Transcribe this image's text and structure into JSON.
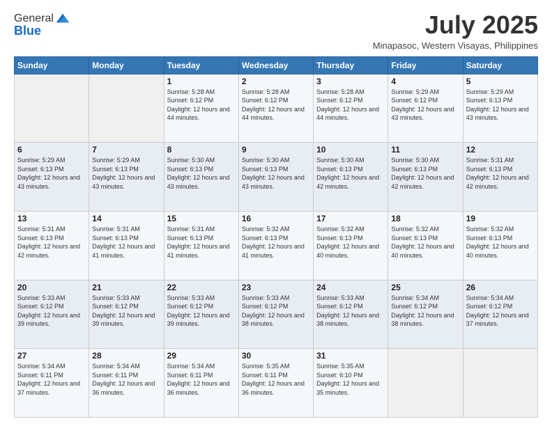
{
  "header": {
    "logo_general": "General",
    "logo_blue": "Blue",
    "month_title": "July 2025",
    "location": "Minapasoc, Western Visayas, Philippines"
  },
  "days_of_week": [
    "Sunday",
    "Monday",
    "Tuesday",
    "Wednesday",
    "Thursday",
    "Friday",
    "Saturday"
  ],
  "weeks": [
    [
      {
        "day": "",
        "info": ""
      },
      {
        "day": "",
        "info": ""
      },
      {
        "day": "1",
        "info": "Sunrise: 5:28 AM\nSunset: 6:12 PM\nDaylight: 12 hours and 44 minutes."
      },
      {
        "day": "2",
        "info": "Sunrise: 5:28 AM\nSunset: 6:12 PM\nDaylight: 12 hours and 44 minutes."
      },
      {
        "day": "3",
        "info": "Sunrise: 5:28 AM\nSunset: 6:12 PM\nDaylight: 12 hours and 44 minutes."
      },
      {
        "day": "4",
        "info": "Sunrise: 5:29 AM\nSunset: 6:12 PM\nDaylight: 12 hours and 43 minutes."
      },
      {
        "day": "5",
        "info": "Sunrise: 5:29 AM\nSunset: 6:13 PM\nDaylight: 12 hours and 43 minutes."
      }
    ],
    [
      {
        "day": "6",
        "info": "Sunrise: 5:29 AM\nSunset: 6:13 PM\nDaylight: 12 hours and 43 minutes."
      },
      {
        "day": "7",
        "info": "Sunrise: 5:29 AM\nSunset: 6:13 PM\nDaylight: 12 hours and 43 minutes."
      },
      {
        "day": "8",
        "info": "Sunrise: 5:30 AM\nSunset: 6:13 PM\nDaylight: 12 hours and 43 minutes."
      },
      {
        "day": "9",
        "info": "Sunrise: 5:30 AM\nSunset: 6:13 PM\nDaylight: 12 hours and 43 minutes."
      },
      {
        "day": "10",
        "info": "Sunrise: 5:30 AM\nSunset: 6:13 PM\nDaylight: 12 hours and 42 minutes."
      },
      {
        "day": "11",
        "info": "Sunrise: 5:30 AM\nSunset: 6:13 PM\nDaylight: 12 hours and 42 minutes."
      },
      {
        "day": "12",
        "info": "Sunrise: 5:31 AM\nSunset: 6:13 PM\nDaylight: 12 hours and 42 minutes."
      }
    ],
    [
      {
        "day": "13",
        "info": "Sunrise: 5:31 AM\nSunset: 6:13 PM\nDaylight: 12 hours and 42 minutes."
      },
      {
        "day": "14",
        "info": "Sunrise: 5:31 AM\nSunset: 6:13 PM\nDaylight: 12 hours and 41 minutes."
      },
      {
        "day": "15",
        "info": "Sunrise: 5:31 AM\nSunset: 6:13 PM\nDaylight: 12 hours and 41 minutes."
      },
      {
        "day": "16",
        "info": "Sunrise: 5:32 AM\nSunset: 6:13 PM\nDaylight: 12 hours and 41 minutes."
      },
      {
        "day": "17",
        "info": "Sunrise: 5:32 AM\nSunset: 6:13 PM\nDaylight: 12 hours and 40 minutes."
      },
      {
        "day": "18",
        "info": "Sunrise: 5:32 AM\nSunset: 6:13 PM\nDaylight: 12 hours and 40 minutes."
      },
      {
        "day": "19",
        "info": "Sunrise: 5:32 AM\nSunset: 6:13 PM\nDaylight: 12 hours and 40 minutes."
      }
    ],
    [
      {
        "day": "20",
        "info": "Sunrise: 5:33 AM\nSunset: 6:12 PM\nDaylight: 12 hours and 39 minutes."
      },
      {
        "day": "21",
        "info": "Sunrise: 5:33 AM\nSunset: 6:12 PM\nDaylight: 12 hours and 39 minutes."
      },
      {
        "day": "22",
        "info": "Sunrise: 5:33 AM\nSunset: 6:12 PM\nDaylight: 12 hours and 39 minutes."
      },
      {
        "day": "23",
        "info": "Sunrise: 5:33 AM\nSunset: 6:12 PM\nDaylight: 12 hours and 38 minutes."
      },
      {
        "day": "24",
        "info": "Sunrise: 5:33 AM\nSunset: 6:12 PM\nDaylight: 12 hours and 38 minutes."
      },
      {
        "day": "25",
        "info": "Sunrise: 5:34 AM\nSunset: 6:12 PM\nDaylight: 12 hours and 38 minutes."
      },
      {
        "day": "26",
        "info": "Sunrise: 5:34 AM\nSunset: 6:12 PM\nDaylight: 12 hours and 37 minutes."
      }
    ],
    [
      {
        "day": "27",
        "info": "Sunrise: 5:34 AM\nSunset: 6:11 PM\nDaylight: 12 hours and 37 minutes."
      },
      {
        "day": "28",
        "info": "Sunrise: 5:34 AM\nSunset: 6:11 PM\nDaylight: 12 hours and 36 minutes."
      },
      {
        "day": "29",
        "info": "Sunrise: 5:34 AM\nSunset: 6:11 PM\nDaylight: 12 hours and 36 minutes."
      },
      {
        "day": "30",
        "info": "Sunrise: 5:35 AM\nSunset: 6:11 PM\nDaylight: 12 hours and 36 minutes."
      },
      {
        "day": "31",
        "info": "Sunrise: 5:35 AM\nSunset: 6:10 PM\nDaylight: 12 hours and 35 minutes."
      },
      {
        "day": "",
        "info": ""
      },
      {
        "day": "",
        "info": ""
      }
    ]
  ]
}
